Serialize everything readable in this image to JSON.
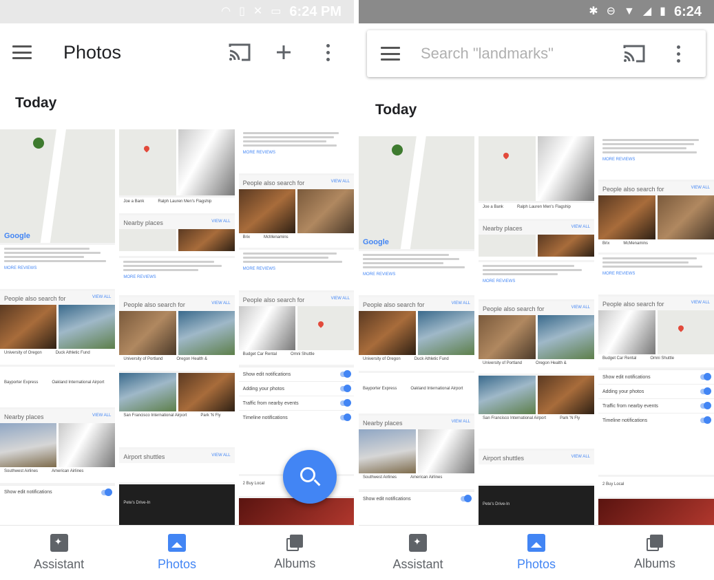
{
  "left": {
    "status": {
      "time": "6:24 PM"
    },
    "appbar": {
      "title": "Photos"
    },
    "section": "Today"
  },
  "right": {
    "status": {
      "time": "6:24"
    },
    "search": {
      "placeholder": "Search \"landmarks\""
    },
    "section": "Today"
  },
  "cards": {
    "people_also_search": "People also search for",
    "view_all": "VIEW ALL",
    "more_reviews": "MORE REVIEWS",
    "nearby_places": "Nearby places",
    "airport_shuttles": "Airport shuttles",
    "map_logo": "Google",
    "place_1": "University of Oregon",
    "place_2": "Duck Athletic Fund",
    "place_3": "University of Portland",
    "place_4": "Oregon Health &",
    "place_5": "Budget Car Rental",
    "place_6": "Omni Shuttle",
    "place_7": "Southwest Airlines",
    "place_8": "American Airlines",
    "place_9": "Bayporter Express",
    "place_10": "Oakland International Airport",
    "place_11": "San Francisco International Airport",
    "place_12": "Park 'N Fly",
    "place_13": "Joe a Bank",
    "place_14": "Ralph Lauren Men's Flagship",
    "place_15": "Brix",
    "place_16": "McMenamins",
    "place_17": "Pete's Drive-In",
    "notif_1": "Show edit notifications",
    "notif_2": "Adding your photos",
    "notif_3": "Traffic from nearby events",
    "notif_4": "Timeline notifications",
    "local": "2 Buy Local",
    "accent": "#4285f4"
  },
  "nav": {
    "assistant": "Assistant",
    "photos": "Photos",
    "albums": "Albums"
  }
}
